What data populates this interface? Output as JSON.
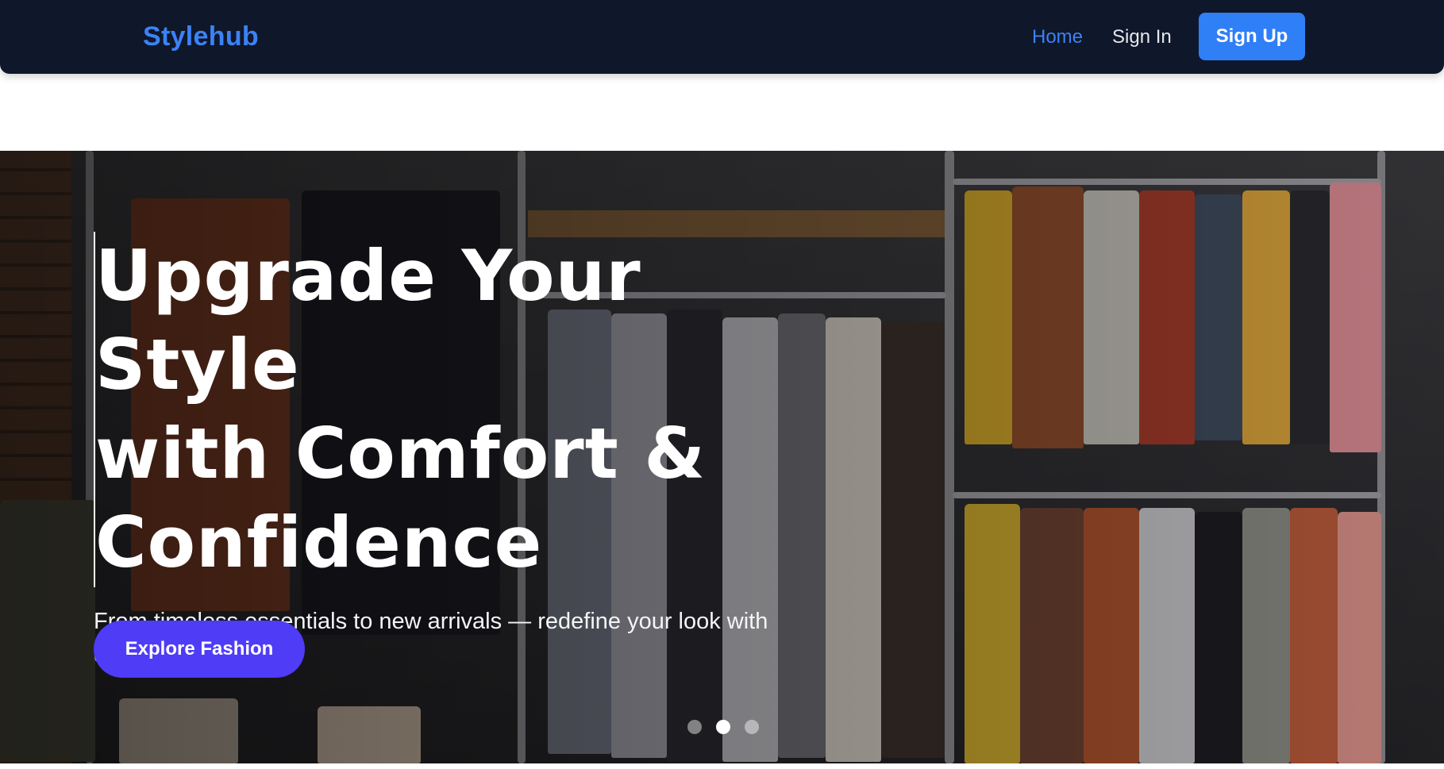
{
  "navbar": {
    "brand": "Stylehub",
    "links": {
      "home": "Home",
      "sign_in": "Sign In"
    },
    "sign_up_label": "Sign Up"
  },
  "hero": {
    "title_lines": [
      "Upgrade Your Style",
      "with Comfort &",
      "Confidence"
    ],
    "subtitle": "From timeless essentials to new arrivals — redefine your look with quality and class.",
    "cta_label": "Explore Fashion",
    "carousel": {
      "slide_count": 3,
      "active_index": 1
    }
  },
  "colors": {
    "navbar_bg": "#0f172a",
    "brand": "#3b82f6",
    "active_link": "#3b82f6",
    "sign_up_button": "#2f7ff7",
    "cta_button": "#4f3cf7"
  }
}
